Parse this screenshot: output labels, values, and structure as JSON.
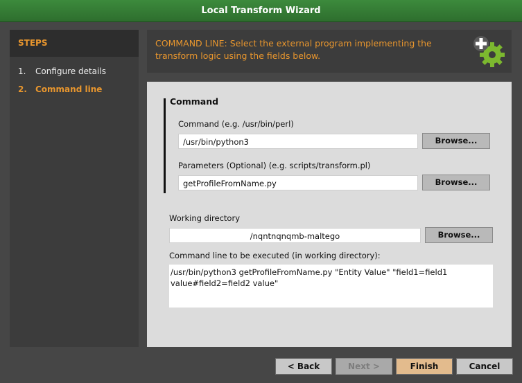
{
  "window": {
    "title": "Local Transform Wizard"
  },
  "steps": {
    "header": "STEPS",
    "items": [
      {
        "num": "1.",
        "label": "Configure details"
      },
      {
        "num": "2.",
        "label": "Command line"
      }
    ]
  },
  "header": {
    "text": "COMMAND LINE: Select the external program implementing the transform logic using the fields below.",
    "icon": "gear-plus-icon",
    "accent_color": "#e8962e",
    "icon_color": "#7cb82f"
  },
  "command": {
    "group_title": "Command",
    "command_label": "Command (e.g. /usr/bin/perl)",
    "command_value": "/usr/bin/python3",
    "params_label": "Parameters (Optional) (e.g. scripts/transform.pl)",
    "params_value": "getProfileFromName.py",
    "browse_label": "Browse..."
  },
  "working_dir": {
    "label": "Working directory",
    "value": "/nqntnqnqmb-maltego",
    "browse_label": "Browse..."
  },
  "cmdline": {
    "label": "Command line to be executed (in working directory):",
    "value": "/usr/bin/python3 getProfileFromName.py \"Entity Value\" \"field1=field1 value#field2=field2 value\""
  },
  "buttons": {
    "back": "< Back",
    "next": "Next >",
    "finish": "Finish",
    "cancel": "Cancel"
  }
}
